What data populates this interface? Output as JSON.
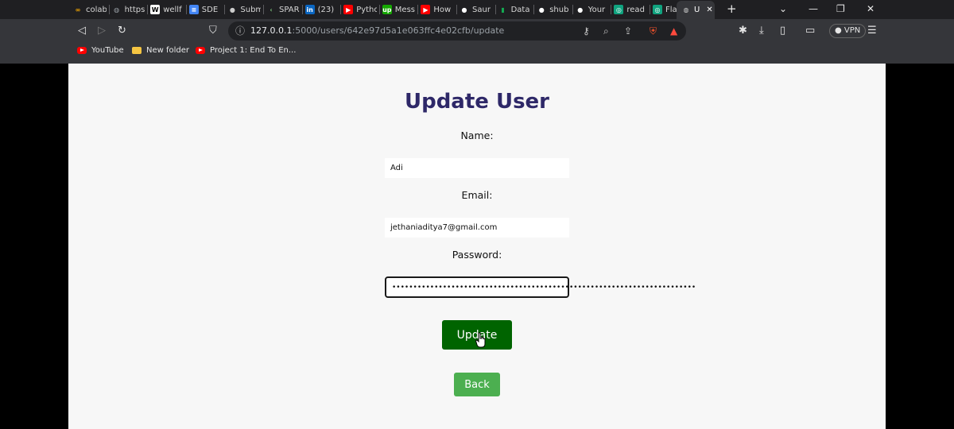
{
  "browser": {
    "tabs": [
      {
        "label": "colab",
        "favicon": "colab-icon",
        "color": "#f9ab00"
      },
      {
        "label": "https",
        "favicon": "globe-icon",
        "color": "#9aa0a6"
      },
      {
        "label": "wellf",
        "favicon": "w-icon",
        "color": "#ffffff"
      },
      {
        "label": "SDE",
        "favicon": "docs-icon",
        "color": "#4285f4"
      },
      {
        "label": "Subm",
        "favicon": "avatar-icon",
        "color": "#cccccc"
      },
      {
        "label": "SPAR",
        "favicon": "arrow-icon",
        "color": "#7cc47c"
      },
      {
        "label": "(23)",
        "favicon": "linkedin-icon",
        "color": "#0a66c2"
      },
      {
        "label": "Pytho",
        "favicon": "youtube-icon",
        "color": "#ff0000"
      },
      {
        "label": "Mess",
        "favicon": "upwork-icon",
        "color": "#14a800"
      },
      {
        "label": "How",
        "favicon": "youtube-icon",
        "color": "#ff0000"
      },
      {
        "label": "Saur",
        "favicon": "github-icon",
        "color": "#ffffff"
      },
      {
        "label": "Data",
        "favicon": "mongodb-icon",
        "color": "#13aa52"
      },
      {
        "label": "shub",
        "favicon": "github-icon",
        "color": "#ffffff"
      },
      {
        "label": "Your",
        "favicon": "github-icon",
        "color": "#ffffff"
      },
      {
        "label": "read",
        "favicon": "chatgpt-icon",
        "color": "#10a37f"
      },
      {
        "label": "Flask",
        "favicon": "chatgpt-icon",
        "color": "#74aa9c"
      }
    ],
    "active_tab": {
      "label": "U",
      "favicon": "globe-icon"
    },
    "url_host": "127.0.0.1",
    "url_path": ":5000/users/642e97d5a1e063ffc4e02cfb/update",
    "vpn_label": "VPN",
    "bookmarks": [
      {
        "label": "YouTube",
        "icon": "youtube-icon"
      },
      {
        "label": "New folder",
        "icon": "folder-icon"
      },
      {
        "label": "Project 1: End To En...",
        "icon": "youtube-icon"
      }
    ]
  },
  "form": {
    "title": "Update User",
    "name_label": "Name:",
    "name_value": "Adi",
    "email_label": "Email:",
    "email_value": "jethaniaditya7@gmail.com",
    "password_label": "Password:",
    "password_value": "••••••••••••••••••••••••••••••••••••••••••••••••••••••••••••••••••••••••",
    "update_label": "Update",
    "back_label": "Back"
  },
  "colors": {
    "title": "#2e2868",
    "update_button": "#006400",
    "back_button": "#4caf50"
  }
}
